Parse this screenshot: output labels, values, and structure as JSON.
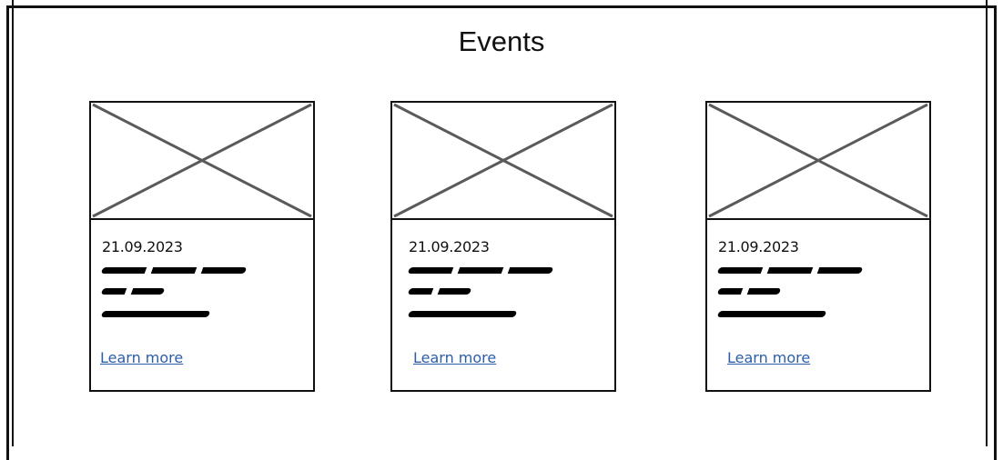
{
  "page": {
    "title": "Events"
  },
  "cards": [
    {
      "date": "21.09.2023",
      "link_label": "Learn more"
    },
    {
      "date": "21.09.2023",
      "link_label": "Learn more"
    },
    {
      "date": "21.09.2023",
      "link_label": "Learn more"
    }
  ],
  "icons": {
    "image_placeholder": "image-placeholder-icon"
  },
  "colors": {
    "link": "#2c5ea8",
    "border": "#111111",
    "placeholder_cross": "#5a5a5a"
  }
}
